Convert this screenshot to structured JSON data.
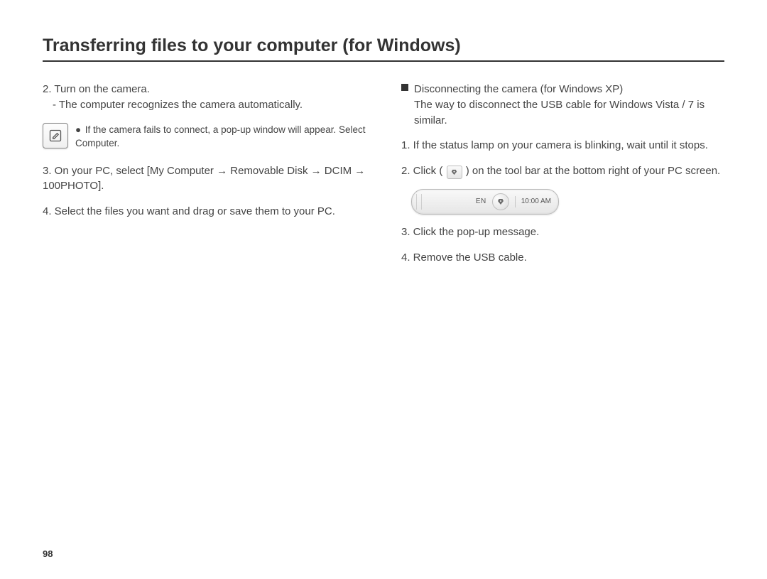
{
  "title": "Transferring files to your computer (for Windows)",
  "left": {
    "step2": "2. Turn on the camera.",
    "step2_sub": "- The computer recognizes the camera automatically.",
    "note": "If the camera fails to connect, a pop-up window will appear. Select Computer.",
    "step3": "3. On your PC, select [My Computer → Removable Disk → DCIM → 100PHOTO].",
    "step4": "4. Select the files you want and drag or save them to your PC."
  },
  "right": {
    "heading": "Disconnecting the camera (for Windows XP)",
    "heading_sub": "The way to disconnect the USB cable for Windows Vista / 7 is similar.",
    "step1": "1. If the status lamp on your camera is blinking, wait until it stops.",
    "step2_a": "2. Click (",
    "step2_b": ") on the tool bar at the bottom right of your PC screen.",
    "tray": {
      "lang": "EN",
      "time": "10:00 AM"
    },
    "step3": "3. Click the pop-up message.",
    "step4": "4. Remove the USB cable."
  },
  "page_number": "98"
}
